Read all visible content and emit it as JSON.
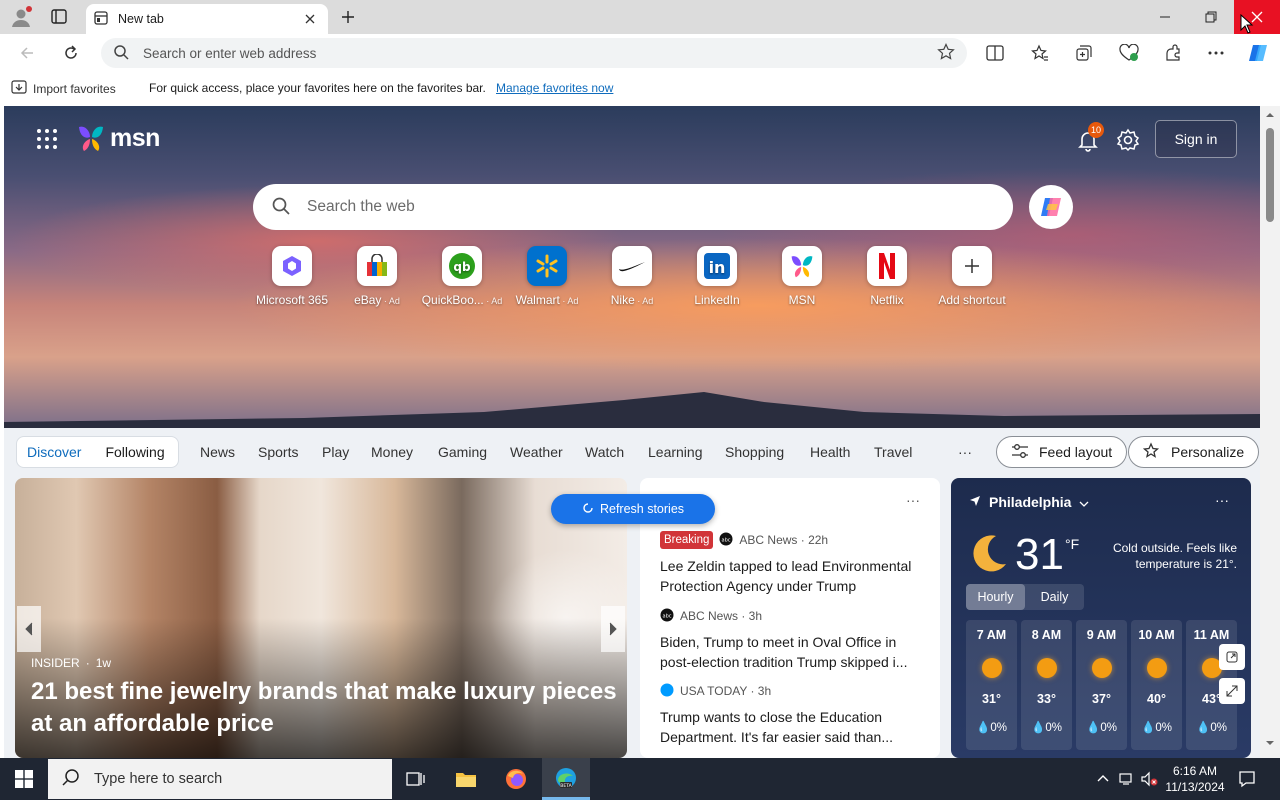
{
  "browser": {
    "tab_title": "New tab",
    "address_placeholder": "Search or enter web address"
  },
  "favbar": {
    "import_label": "Import favorites",
    "message": "For quick access, place your favorites here on the favorites bar.",
    "manage_link": "Manage favorites now"
  },
  "msn": {
    "logo_text": "msn",
    "notification_count": "10",
    "signin_label": "Sign in",
    "search_placeholder": "Search the web",
    "shortcuts": [
      {
        "label": "Microsoft 365",
        "ad": "",
        "icon": "microsoft365-icon"
      },
      {
        "label": "eBay",
        "ad": " · Ad",
        "icon": "ebay-icon"
      },
      {
        "label": "QuickBoo...",
        "ad": " · Ad",
        "icon": "quickbooks-icon"
      },
      {
        "label": "Walmart",
        "ad": " · Ad",
        "icon": "walmart-icon"
      },
      {
        "label": "Nike",
        "ad": " · Ad",
        "icon": "nike-icon"
      },
      {
        "label": "LinkedIn",
        "ad": "",
        "icon": "linkedin-icon"
      },
      {
        "label": "MSN",
        "ad": "",
        "icon": "msn-icon"
      },
      {
        "label": "Netflix",
        "ad": "",
        "icon": "netflix-icon"
      },
      {
        "label": "Add shortcut",
        "ad": "",
        "icon": "plus-icon"
      }
    ]
  },
  "nav": {
    "discover": "Discover",
    "following": "Following",
    "items": [
      "News",
      "Sports",
      "Play",
      "Money",
      "Gaming",
      "Weather",
      "Watch",
      "Learning",
      "Shopping",
      "Health",
      "Travel"
    ],
    "more": "···",
    "feed_layout": "Feed layout",
    "personalize": "Personalize"
  },
  "hero_card": {
    "source": "INSIDER",
    "age": "1w",
    "title": "21 best fine jewelry brands that make luxury pieces at an affordable price"
  },
  "refresh_label": "Refresh stories",
  "news": {
    "header": "tories",
    "more": "···",
    "stories": [
      {
        "badge": "Breaking",
        "source": "ABC News · 22h",
        "title": "Lee Zeldin tapped to lead Environmental Protection Agency under Trump"
      },
      {
        "badge": "",
        "source": "ABC News · 3h",
        "title": "Biden, Trump to meet in Oval Office in post-election tradition Trump skipped i..."
      },
      {
        "badge": "",
        "source": "USA TODAY · 3h",
        "title": "Trump wants to close the Education Department. It's far easier said than..."
      }
    ]
  },
  "weather": {
    "location": "Philadelphia",
    "more": "···",
    "temp": "31",
    "unit": "°F",
    "description": "Cold outside. Feels like temperature is 21°.",
    "tab_hourly": "Hourly",
    "tab_daily": "Daily",
    "hours": [
      {
        "time": "7 AM",
        "temp": "31°",
        "precip": "0%"
      },
      {
        "time": "8 AM",
        "temp": "33°",
        "precip": "0%"
      },
      {
        "time": "9 AM",
        "temp": "37°",
        "precip": "0%"
      },
      {
        "time": "10 AM",
        "temp": "40°",
        "precip": "0%"
      },
      {
        "time": "11 AM",
        "temp": "43°",
        "precip": "0%"
      }
    ]
  },
  "taskbar": {
    "search_placeholder": "Type here to search",
    "time": "6:16 AM",
    "date": "11/13/2024"
  },
  "colors": {
    "accent": "#0f6cbd",
    "close_red": "#e81123",
    "breaking": "#d13438",
    "refresh_blue": "#1a73e8"
  }
}
